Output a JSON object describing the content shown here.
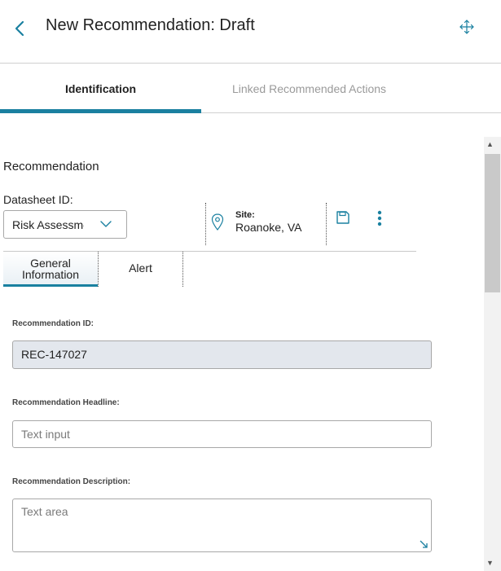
{
  "header": {
    "title": "New Recommendation: Draft",
    "back_icon": "chevron-left-icon",
    "move_icon": "move-arrows-icon",
    "accent_color": "#1a80a0"
  },
  "tabs": [
    {
      "label": "Identification",
      "active": true
    },
    {
      "label": "Linked Recommended Actions",
      "active": false
    }
  ],
  "section": {
    "title": "Recommendation",
    "datasheet_label": "Datasheet ID:",
    "datasheet_value": "Risk Assessme",
    "site_label": "Site:",
    "site_value": "Roanoke, VA",
    "save_icon": "floppy-disk-icon",
    "more_icon": "vertical-dots-icon"
  },
  "subtabs": [
    {
      "label": "General Information",
      "active": true
    },
    {
      "label": "Alert",
      "active": false
    }
  ],
  "fields": {
    "rec_id_label": "Recommendation ID:",
    "rec_id_value": "REC-147027",
    "headline_label": "Recommendation Headline:",
    "headline_placeholder": "Text input",
    "description_label": "Recommendation Description:",
    "description_placeholder": "Text area"
  }
}
